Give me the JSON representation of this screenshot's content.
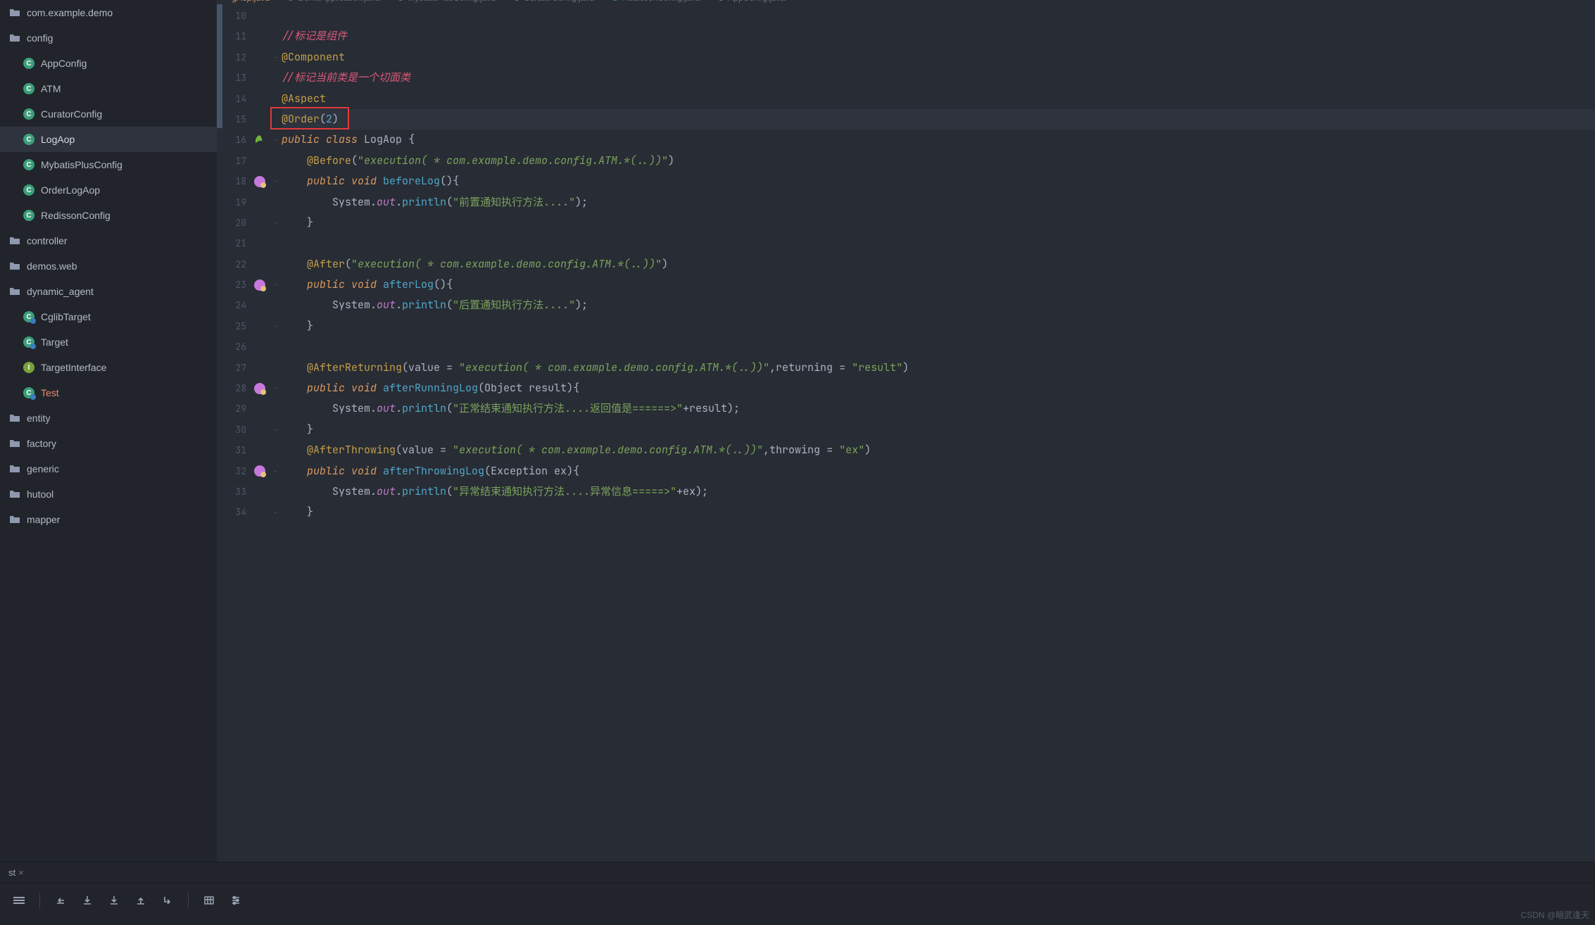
{
  "watermark": "CSDN @暗武逢天",
  "sidebar": {
    "root": "com.example.demo",
    "items": [
      {
        "type": "folder",
        "label": "config",
        "depth": 1
      },
      {
        "type": "class",
        "label": "AppConfig",
        "depth": 2
      },
      {
        "type": "class",
        "label": "ATM",
        "depth": 2
      },
      {
        "type": "class",
        "label": "CuratorConfig",
        "depth": 2
      },
      {
        "type": "class",
        "label": "LogAop",
        "depth": 2,
        "selected": true
      },
      {
        "type": "class",
        "label": "MybatisPlusConfig",
        "depth": 2
      },
      {
        "type": "class",
        "label": "OrderLogAop",
        "depth": 2
      },
      {
        "type": "class",
        "label": "RedissonConfig",
        "depth": 2
      },
      {
        "type": "folder",
        "label": "controller",
        "depth": 1
      },
      {
        "type": "folder",
        "label": "demos.web",
        "depth": 1
      },
      {
        "type": "folder",
        "label": "dynamic_agent",
        "depth": 1
      },
      {
        "type": "class-half",
        "label": "CglibTarget",
        "depth": 2
      },
      {
        "type": "class-half",
        "label": "Target",
        "depth": 2
      },
      {
        "type": "interface",
        "label": "TargetInterface",
        "depth": 2
      },
      {
        "type": "class-half",
        "label": "Test",
        "depth": 2,
        "orange": true
      },
      {
        "type": "folder",
        "label": "entity",
        "depth": 1
      },
      {
        "type": "folder",
        "label": "factory",
        "depth": 1
      },
      {
        "type": "folder",
        "label": "generic",
        "depth": 1
      },
      {
        "type": "folder",
        "label": "hutool",
        "depth": 1
      },
      {
        "type": "folder",
        "label": "mapper",
        "depth": 1
      }
    ]
  },
  "tabs": {
    "active": "gAop.java",
    "others": [
      "DemoApplication.java",
      "MybatisPlusConfig.java",
      "CuratorConfig.java",
      "RedissonConfig.java",
      "AppConfig.java"
    ]
  },
  "editor": {
    "firstLine": 10,
    "lines": [
      {
        "n": 10,
        "stripe": true,
        "html": ""
      },
      {
        "n": 11,
        "stripe": true,
        "html": "<span class='c-comment'>//标记是组件</span>"
      },
      {
        "n": 12,
        "stripe": true,
        "fold": "⊖",
        "html": "<span class='c-anno'>@Component</span>"
      },
      {
        "n": 13,
        "stripe": true,
        "html": "<span class='c-comment'>//标记当前类是一个切面类</span>"
      },
      {
        "n": 14,
        "stripe": true,
        "html": "<span class='c-anno'>@Aspect</span>"
      },
      {
        "n": 15,
        "stripe": true,
        "hl": true,
        "redbox": true,
        "html": "<span class='c-anno'>@Order</span><span class='c-op'>(</span><span class='c-num'>2</span><span class='c-op'>)</span>"
      },
      {
        "n": 16,
        "icon": "leaf",
        "fold": "⊖",
        "html": "<span class='c-keyword'>public class</span> <span class='c-type'>LogAop</span> <span class='c-op'>{</span>"
      },
      {
        "n": 17,
        "html": "    <span class='c-anno'>@Before</span><span class='c-op'>(</span><span class='c-string'>\"</span><span class='c-string' style='font-style:italic'>execution( * com.example.demo.config.ATM.*(..))</span><span class='c-string'>\"</span><span class='c-op'>)</span>"
      },
      {
        "n": 18,
        "icon": "aop",
        "fold": "⊖",
        "html": "    <span class='c-keyword'>public void</span> <span class='c-method'>beforeLog</span><span class='c-op'>(){</span>"
      },
      {
        "n": 19,
        "html": "        <span class='c-type'>System</span><span class='c-op'>.</span><span class='c-static'>out</span><span class='c-op'>.</span><span class='c-method'>println</span><span class='c-op'>(</span><span class='c-string'>\"前置通知执行方法....\"</span><span class='c-op'>);</span>"
      },
      {
        "n": 20,
        "fold": "⊖",
        "html": "    <span class='c-op'>}</span>"
      },
      {
        "n": 21,
        "html": ""
      },
      {
        "n": 22,
        "html": "    <span class='c-anno'>@After</span><span class='c-op'>(</span><span class='c-string'>\"</span><span class='c-string' style='font-style:italic'>execution( * com.example.demo.config.ATM.*(..))</span><span class='c-string'>\"</span><span class='c-op'>)</span>"
      },
      {
        "n": 23,
        "icon": "aop",
        "fold": "⊖",
        "html": "    <span class='c-keyword'>public void</span> <span class='c-method'>afterLog</span><span class='c-op'>(){</span>"
      },
      {
        "n": 24,
        "html": "        <span class='c-type'>System</span><span class='c-op'>.</span><span class='c-static'>out</span><span class='c-op'>.</span><span class='c-method'>println</span><span class='c-op'>(</span><span class='c-string'>\"后置通知执行方法....\"</span><span class='c-op'>);</span>"
      },
      {
        "n": 25,
        "fold": "⊖",
        "html": "    <span class='c-op'>}</span>"
      },
      {
        "n": 26,
        "html": ""
      },
      {
        "n": 27,
        "html": "    <span class='c-anno'>@AfterReturning</span><span class='c-op'>(</span><span class='c-param'>value</span> <span class='c-op'>=</span> <span class='c-string'>\"</span><span class='c-string' style='font-style:italic'>execution( * com.example.demo.config.ATM.*(..))</span><span class='c-string'>\"</span><span class='c-op'>,</span><span class='c-param'>returning</span> <span class='c-op'>=</span> <span class='c-string'>\"result\"</span><span class='c-op'>)</span>"
      },
      {
        "n": 28,
        "icon": "aop",
        "fold": "⊖",
        "html": "    <span class='c-keyword'>public void</span> <span class='c-method'>afterRunningLog</span><span class='c-op'>(</span><span class='c-type'>Object</span> <span class='c-param'>result</span><span class='c-op'>){</span>"
      },
      {
        "n": 29,
        "html": "        <span class='c-type'>System</span><span class='c-op'>.</span><span class='c-static'>out</span><span class='c-op'>.</span><span class='c-method'>println</span><span class='c-op'>(</span><span class='c-string'>\"正常结束通知执行方法....返回值是======>\"</span><span class='c-op'>+</span><span class='c-param'>result</span><span class='c-op'>);</span>"
      },
      {
        "n": 30,
        "fold": "⊖",
        "html": "    <span class='c-op'>}</span>"
      },
      {
        "n": 31,
        "html": "    <span class='c-anno'>@AfterThrowing</span><span class='c-op'>(</span><span class='c-param'>value</span> <span class='c-op'>=</span> <span class='c-string'>\"</span><span class='c-string' style='font-style:italic'>execution( * com.example.demo.config.ATM.*(..))</span><span class='c-string'>\"</span><span class='c-op'>,</span><span class='c-param'>throwing</span> <span class='c-op'>=</span> <span class='c-string'>\"ex\"</span><span class='c-op'>)</span>"
      },
      {
        "n": 32,
        "icon": "aop",
        "fold": "⊖",
        "html": "    <span class='c-keyword'>public void</span> <span class='c-method'>afterThrowingLog</span><span class='c-op'>(</span><span class='c-type'>Exception</span> <span class='c-param'>ex</span><span class='c-op'>){</span>"
      },
      {
        "n": 33,
        "html": "        <span class='c-type'>System</span><span class='c-op'>.</span><span class='c-static'>out</span><span class='c-op'>.</span><span class='c-method'>println</span><span class='c-op'>(</span><span class='c-string'>\"异常结束通知执行方法....异常信息=====>\"</span><span class='c-op'>+</span><span class='c-param'>ex</span><span class='c-op'>);</span>"
      },
      {
        "n": 34,
        "fold": "⊖",
        "html": "    <span class='c-op'>}</span>"
      }
    ]
  },
  "bottomTabs": [
    "st"
  ],
  "toolbarIcons": [
    "menu",
    "sep",
    "indent-left",
    "download",
    "download",
    "upload",
    "arrow-down-right",
    "sep",
    "table",
    "settings-list"
  ]
}
